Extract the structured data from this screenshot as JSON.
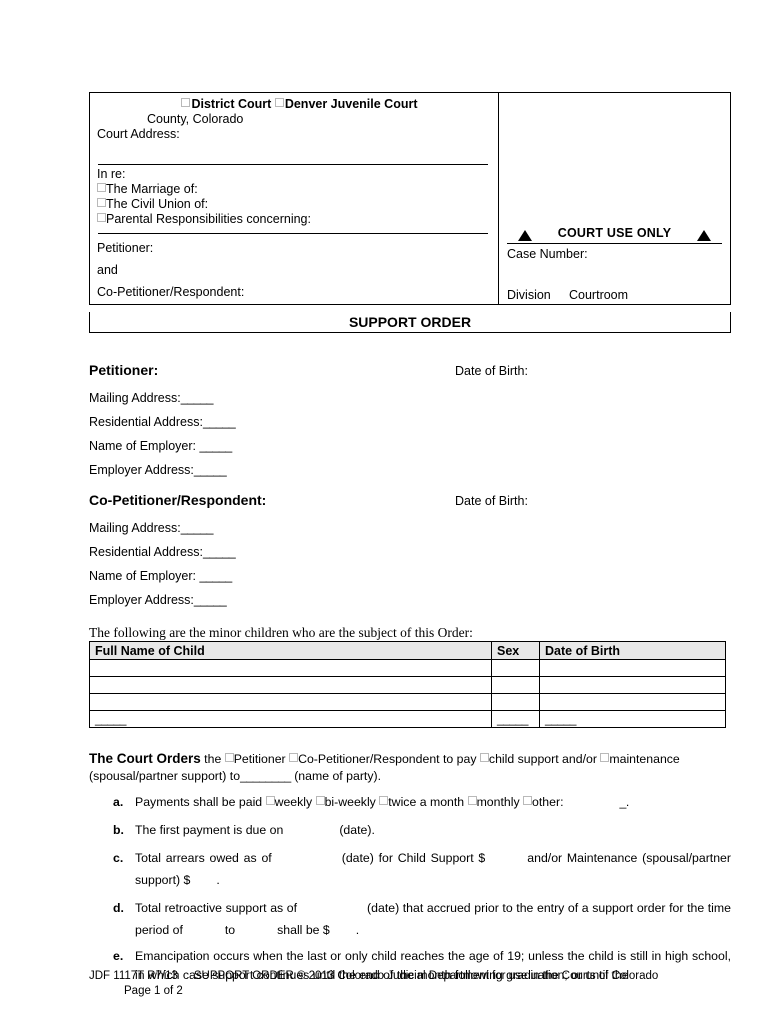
{
  "caption": {
    "court_types": [
      {
        "label": "District Court"
      },
      {
        "label": "Denver Juvenile Court"
      }
    ],
    "county_line": "County, Colorado",
    "court_address_label": "Court Address:",
    "in_re_label": "In re:",
    "in_re_options": [
      {
        "label": "The Marriage of:"
      },
      {
        "label": "The Civil Union of:"
      },
      {
        "label": "Parental Responsibilities concerning:"
      }
    ],
    "petitioner_label": "Petitioner:",
    "and_label": "and",
    "co_petitioner_label": "Co-Petitioner/Respondent:",
    "court_use_only": "COURT USE ONLY",
    "case_number_label": "Case Number:",
    "division_label": "Division",
    "courtroom_label": "Courtroom"
  },
  "banner_title": "SUPPORT ORDER",
  "petitioner": {
    "heading": "Petitioner:",
    "dob_label": "Date of Birth:",
    "fields": [
      {
        "label": "Mailing Address:",
        "value": "_____"
      },
      {
        "label": "Residential Address:",
        "value": "_____"
      },
      {
        "label": "Name of Employer: ",
        "value": "_____"
      },
      {
        "label": "Employer Address:",
        "value": "_____"
      }
    ]
  },
  "co_petitioner": {
    "heading": "Co-Petitioner/Respondent:",
    "dob_label": "Date of Birth:",
    "fields": [
      {
        "label": "Mailing Address:",
        "value": "_____"
      },
      {
        "label": "Residential Address:",
        "value": "_____"
      },
      {
        "label": "Name of Employer: ",
        "value": "_____"
      },
      {
        "label": "Employer Address:",
        "value": "_____"
      }
    ]
  },
  "children": {
    "intro": "The following are the minor children who are the subject of this Order:",
    "columns": [
      "Full Name of Child",
      "Sex",
      "Date of Birth"
    ],
    "rows": [
      {
        "name": "",
        "sex": "",
        "dob": ""
      },
      {
        "name": "",
        "sex": "",
        "dob": ""
      },
      {
        "name": "",
        "sex": "",
        "dob": ""
      },
      {
        "name": "_____",
        "sex": "_____",
        "dob": "_____"
      }
    ]
  },
  "orders": {
    "lead_bold": "The Court Orders",
    "lead_the": " the ",
    "opt_petitioner": "Petitioner",
    "opt_co_petitioner": "Co-Petitioner/Respondent",
    "lead_to_pay": " to pay ",
    "opt_child_support": "child support and/or ",
    "opt_maintenance": "maintenance",
    "lead_tail_1": "(spousal/partner support) to",
    "lead_blank": "________",
    "lead_tail_2": " (name of party).",
    "items": [
      {
        "mark": "a.",
        "text_1": "Payments shall be paid ",
        "opts": [
          "weekly",
          "bi-weekly",
          "twice a month",
          "monthly",
          "other:"
        ],
        "trailing_blank": "_."
      },
      {
        "mark": "b.",
        "text_1": "The first payment is due on",
        "text_2": "(date)."
      },
      {
        "mark": "c.",
        "text_1": "Total arrears owed as of",
        "text_2": "(date) for Child Support $",
        "text_3": "and/or Maintenance (spousal/partner support) $",
        "text_4": "."
      },
      {
        "mark": "d.",
        "text_1": "Total retroactive support as of",
        "text_2": "(date) that accrued prior to the entry of a support order for the time period of",
        "text_3": "to",
        "text_4": "shall be $",
        "text_5": "."
      },
      {
        "mark": "e.",
        "text_1": "Emancipation occurs when the last or only child reaches the age of 19; unless the child is still in high school, in which case support continues until the end of the month following graduation; or until the"
      }
    ]
  },
  "footer": {
    "form_number": "JDF 1117T",
    "revision": "R7/13",
    "copyright": "SUPPORT ORDER © 2013 Colorado Judicial Department for use in the Courts of Colorado",
    "page": "Page 1 of 2"
  }
}
